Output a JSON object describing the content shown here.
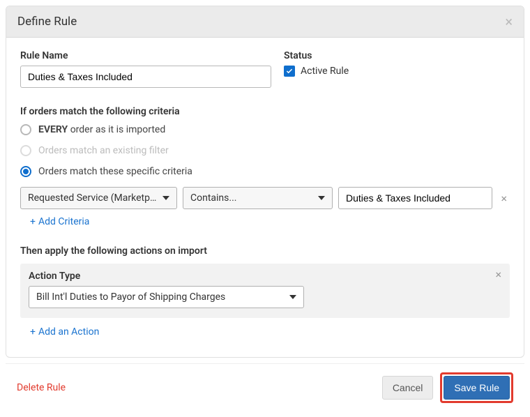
{
  "header": {
    "title": "Define Rule"
  },
  "ruleName": {
    "label": "Rule Name",
    "value": "Duties & Taxes Included"
  },
  "status": {
    "label": "Status",
    "checkboxLabel": "Active Rule",
    "checked": true
  },
  "criteriaSection": {
    "label": "If orders match the following criteria",
    "options": {
      "every_prefix": "EVERY",
      "every_suffix": " order as it is imported",
      "existing": "Orders match an existing filter",
      "specific": "Orders match these specific criteria"
    },
    "selected": "specific",
    "row": {
      "field": "Requested Service (Marketplac…",
      "operator": "Contains...",
      "value": "Duties & Taxes Included"
    },
    "addLink": "Add Criteria"
  },
  "actionsSection": {
    "label": "Then apply the following actions on import",
    "actionTypeLabel": "Action Type",
    "actionValue": "Bill Int'l Duties to Payor of Shipping Charges",
    "addLink": "Add an Action"
  },
  "footer": {
    "delete": "Delete Rule",
    "cancel": "Cancel",
    "save": "Save Rule"
  }
}
